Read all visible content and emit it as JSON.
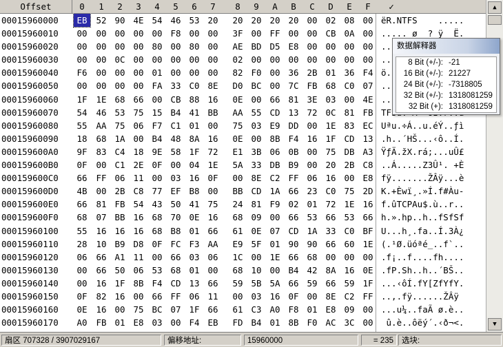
{
  "header": {
    "offset_label": "Offset",
    "columns": [
      "0",
      "1",
      "2",
      "3",
      "4",
      "5",
      "6",
      "7",
      "8",
      "9",
      "A",
      "B",
      "C",
      "D",
      "E",
      "F"
    ],
    "ascii_marker": "✓"
  },
  "rows": [
    {
      "offset": "00015960000",
      "bytes": [
        "EB",
        "52",
        "90",
        "4E",
        "54",
        "46",
        "53",
        "20",
        "20",
        "20",
        "20",
        "20",
        "00",
        "02",
        "08",
        "00",
        "00"
      ],
      "ascii": "ëR.NTFS    ....."
    },
    {
      "offset": "00015960010",
      "bytes": [
        "00",
        "00",
        "00",
        "00",
        "00",
        "F8",
        "00",
        "00",
        "3F",
        "00",
        "FF",
        "00",
        "00",
        "CB",
        "0A",
        "00"
      ],
      "ascii": "..... ø  ? ÿ  Ë."
    },
    {
      "offset": "00015960020",
      "bytes": [
        "00",
        "00",
        "00",
        "00",
        "80",
        "00",
        "80",
        "00",
        "AE",
        "BD",
        "D5",
        "E8",
        "00",
        "00",
        "00",
        "00"
      ],
      "ascii": "....€.€.®½Õè...."
    },
    {
      "offset": "00015960030",
      "bytes": [
        "00",
        "00",
        "0C",
        "00",
        "00",
        "00",
        "00",
        "00",
        "02",
        "00",
        "00",
        "00",
        "00",
        "00",
        "00",
        "00"
      ],
      "ascii": "................"
    },
    {
      "offset": "00015960040",
      "bytes": [
        "F6",
        "00",
        "00",
        "00",
        "01",
        "00",
        "00",
        "00",
        "82",
        "F0",
        "00",
        "36",
        "2B",
        "01",
        "36",
        "F4"
      ],
      "ascii": "ö.......‚ð.6+.6ô"
    },
    {
      "offset": "00015960050",
      "bytes": [
        "00",
        "00",
        "00",
        "00",
        "FA",
        "33",
        "C0",
        "8E",
        "D0",
        "BC",
        "00",
        "7C",
        "FB",
        "68",
        "C0",
        "07"
      ],
      "ascii": "....ú3ÀŽÐ¼.|ûhÀ."
    },
    {
      "offset": "00015960060",
      "bytes": [
        "1F",
        "1E",
        "68",
        "66",
        "00",
        "CB",
        "88",
        "16",
        "0E",
        "00",
        "66",
        "81",
        "3E",
        "03",
        "00",
        "4E"
      ],
      "ascii": "..hf.Ëˆ...f.>..N"
    },
    {
      "offset": "00015960070",
      "bytes": [
        "54",
        "46",
        "53",
        "75",
        "15",
        "B4",
        "41",
        "BB",
        "AA",
        "55",
        "CD",
        "13",
        "72",
        "0C",
        "81",
        "FB"
      ],
      "ascii": "TFSu.´A»ªUÍ.r..û"
    },
    {
      "offset": "00015960080",
      "bytes": [
        "55",
        "AA",
        "75",
        "06",
        "F7",
        "C1",
        "01",
        "00",
        "75",
        "03",
        "E9",
        "DD",
        "00",
        "1E",
        "83",
        "EC"
      ],
      "ascii": "Uªu.÷Á..u.éÝ..ƒì"
    },
    {
      "offset": "00015960090",
      "bytes": [
        "18",
        "68",
        "1A",
        "00",
        "B4",
        "48",
        "8A",
        "16",
        "0E",
        "00",
        "8B",
        "F4",
        "16",
        "1F",
        "CD",
        "13"
      ],
      "ascii": ".h..´HŠ...‹ô..Í."
    },
    {
      "offset": "000159600A0",
      "bytes": [
        "9F",
        "83",
        "C4",
        "18",
        "9E",
        "58",
        "1F",
        "72",
        "E1",
        "3B",
        "06",
        "0B",
        "00",
        "75",
        "DB",
        "A3"
      ],
      "ascii": "ŸƒÄ.žX.rá;...uÛ£"
    },
    {
      "offset": "000159600B0",
      "bytes": [
        "0F",
        "00",
        "C1",
        "2E",
        "0F",
        "00",
        "04",
        "1E",
        "5A",
        "33",
        "DB",
        "B9",
        "00",
        "20",
        "2B",
        "C8"
      ],
      "ascii": "..Á.....Z3Û¹. +È"
    },
    {
      "offset": "000159600C0",
      "bytes": [
        "66",
        "FF",
        "06",
        "11",
        "00",
        "03",
        "16",
        "0F",
        "00",
        "8E",
        "C2",
        "FF",
        "06",
        "16",
        "00",
        "E8"
      ],
      "ascii": "fÿ.......ŽÂÿ...è"
    },
    {
      "offset": "000159600D0",
      "bytes": [
        "4B",
        "00",
        "2B",
        "C8",
        "77",
        "EF",
        "B8",
        "00",
        "BB",
        "CD",
        "1A",
        "66",
        "23",
        "C0",
        "75",
        "2D"
      ],
      "ascii": "K.+Èwï¸.»Í.f#Àu-"
    },
    {
      "offset": "000159600E0",
      "bytes": [
        "66",
        "81",
        "FB",
        "54",
        "43",
        "50",
        "41",
        "75",
        "24",
        "81",
        "F9",
        "02",
        "01",
        "72",
        "1E",
        "16"
      ],
      "ascii": "f.ûTCPAu$.ù..r.."
    },
    {
      "offset": "000159600F0",
      "bytes": [
        "68",
        "07",
        "BB",
        "16",
        "68",
        "70",
        "0E",
        "16",
        "68",
        "09",
        "00",
        "66",
        "53",
        "66",
        "53",
        "66"
      ],
      "ascii": "h.».hp..h..fSfSf"
    },
    {
      "offset": "00015960100",
      "bytes": [
        "55",
        "16",
        "16",
        "16",
        "68",
        "B8",
        "01",
        "66",
        "61",
        "0E",
        "07",
        "CD",
        "1A",
        "33",
        "C0",
        "BF"
      ],
      "ascii": "U...h¸.fa..Í.3À¿"
    },
    {
      "offset": "00015960110",
      "bytes": [
        "28",
        "10",
        "B9",
        "D8",
        "0F",
        "FC",
        "F3",
        "AA",
        "E9",
        "5F",
        "01",
        "90",
        "90",
        "66",
        "60",
        "1E"
      ],
      "ascii": "(.¹Ø.üóªé_..f`.."
    },
    {
      "offset": "00015960120",
      "bytes": [
        "06",
        "66",
        "A1",
        "11",
        "00",
        "66",
        "03",
        "06",
        "1C",
        "00",
        "1E",
        "66",
        "68",
        "00",
        "00",
        "00"
      ],
      "ascii": ".f¡..f....fh...."
    },
    {
      "offset": "00015960130",
      "bytes": [
        "00",
        "66",
        "50",
        "06",
        "53",
        "68",
        "01",
        "00",
        "68",
        "10",
        "00",
        "B4",
        "42",
        "8A",
        "16",
        "0E"
      ],
      "ascii": ".fP.Sh..h..´BŠ.."
    },
    {
      "offset": "00015960140",
      "bytes": [
        "00",
        "16",
        "1F",
        "8B",
        "F4",
        "CD",
        "13",
        "66",
        "59",
        "5B",
        "5A",
        "66",
        "59",
        "66",
        "59",
        "1F"
      ],
      "ascii": "...‹ôÍ.fY[ZfYfY."
    },
    {
      "offset": "00015960150",
      "bytes": [
        "0F",
        "82",
        "16",
        "00",
        "66",
        "FF",
        "06",
        "11",
        "00",
        "03",
        "16",
        "0F",
        "00",
        "8E",
        "C2",
        "FF"
      ],
      "ascii": "..‚.fÿ......ŽÂÿ"
    },
    {
      "offset": "00015960160",
      "bytes": [
        "0E",
        "16",
        "00",
        "75",
        "BC",
        "07",
        "1F",
        "66",
        "61",
        "C3",
        "A0",
        "F8",
        "01",
        "E8",
        "09",
        "00"
      ],
      "ascii": "...u¼..faÃ ø.è.."
    },
    {
      "offset": "00015960170",
      "bytes": [
        "A0",
        "FB",
        "01",
        "E8",
        "03",
        "00",
        "F4",
        "EB",
        "FD",
        "B4",
        "01",
        "8B",
        "F0",
        "AC",
        "3C",
        "00"
      ],
      "ascii": " û.è..ôëý´.‹ð¬<."
    }
  ],
  "interpreter": {
    "title": "数据解释器",
    "rows": [
      {
        "label": "8 Bit (+/-):",
        "value": "-21"
      },
      {
        "label": "16 Bit (+/-):",
        "value": "21227"
      },
      {
        "label": "24 Bit (+/-):",
        "value": "-7318805"
      },
      {
        "label": "32 Bit (+/-):",
        "value": "1318081259"
      },
      {
        "label": "32 Bit (+):",
        "value": "1318081259"
      }
    ]
  },
  "status": {
    "sector": "扇区 707328 / 3907029167",
    "offset_label": "偏移地址:",
    "offset_value": "15960000",
    "value": "= 235",
    "selection_label": "选块:"
  }
}
